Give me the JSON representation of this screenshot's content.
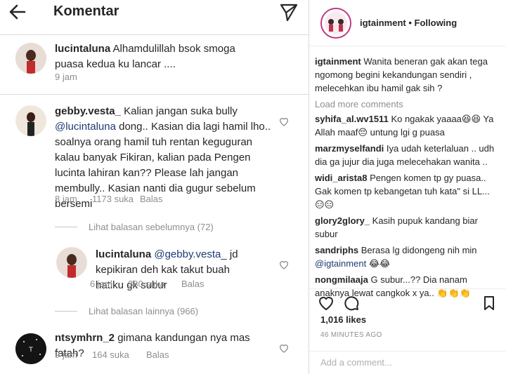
{
  "left": {
    "title": "Komentar",
    "comments": [
      {
        "user": "lucintaluna",
        "text": "Alhamdulillah bsok smoga puasa kedua ku lancar ....",
        "time": "9 jam"
      },
      {
        "user": "gebby.vesta_",
        "text_a": "Kalian jangan suka bully",
        "mention": "@lucintaluna",
        "text_b": "dong.. Kasian dia lagi hamil lho.. soalnya orang hamil tuh rentan keguguran kalau banyak Fikiran, kalian pada Pengen lucinta lahiran kan?? Please lah jangan membully.. Kasian nanti dia gugur sebelum bersemi",
        "time": "8 jam",
        "likes": "1173 suka",
        "reply": "Balas",
        "view_previous": "Lihat balasan sebelumnya (72)"
      },
      {
        "user": "lucintaluna",
        "mention": "@gebby.vesta_",
        "text": "jd kepikiran deh kak takut buah hatiku gk subur",
        "time": "6 jam",
        "likes": "380 suka",
        "reply": "Balas",
        "view_more": "Lihat balasan lainnya (966)"
      },
      {
        "user": "ntsymhrn_2",
        "text": "gimana kandungan nya mas fatah?",
        "time": "9 jam",
        "likes": "164 suka",
        "reply": "Balas"
      }
    ]
  },
  "right": {
    "account": "igtainment",
    "follow_status": "• Following",
    "caption_user": "igtainment",
    "caption": "Wanita beneran gak akan tega ngomong begini kekandungan sendiri , melecehkan ibu hamil gak sih ?",
    "load_more": "Load more comments",
    "comments": [
      {
        "user": "syhifa_al.wv1511",
        "text": "Ko ngakak yaaaa😆😆 Ya Allah maaf😔 untung lgi g puasa"
      },
      {
        "user": "marzmyselfandi",
        "text": "Iya udah keterlaluan .. udh dia ga jujur dia juga melecehakan wanita .."
      },
      {
        "user": "widi_arista8",
        "text": "Pengen komen tp gy puasa.. Gak komen tp kebangetan tuh kata\" si LL... 😑😑"
      },
      {
        "user": "glory2glory_",
        "text": "Kasih pupuk kandang biar subur"
      },
      {
        "user": "sandriphs",
        "text": "Berasa lg didongeng nih min",
        "mention": "@igtainment",
        "tail": "😂😂"
      },
      {
        "user": "nongmilaaja",
        "text": "G subur...?? Dia nanam anaknya lewat cangkok x ya.. 👏👏👏"
      }
    ],
    "likes": "1,016 likes",
    "timestamp": "46 MINUTES AGO",
    "add_comment_placeholder": "Add a comment..."
  },
  "colors": {
    "text": "#262626",
    "muted": "#8e8e8e",
    "mention": "#1d3b73",
    "border": "#dbdbdb"
  },
  "icons": [
    "back-arrow-icon",
    "send-icon",
    "heart-icon",
    "comment-icon",
    "bookmark-icon"
  ]
}
